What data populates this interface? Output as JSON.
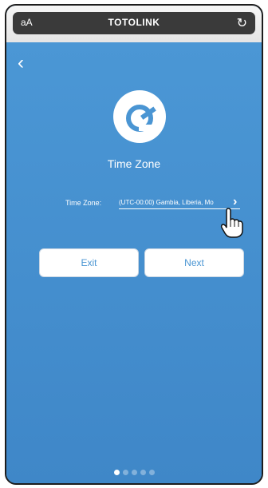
{
  "browser": {
    "text_size_label": "aA",
    "url_title": "TOTOLINK"
  },
  "page": {
    "title": "Time Zone",
    "time_zone_label": "Time Zone:",
    "time_zone_value": "(UTC-00:00) Gambia, Liberia, Mo",
    "buttons": {
      "exit": "Exit",
      "next": "Next"
    },
    "pagination": {
      "total": 5,
      "current": 1
    }
  },
  "colors": {
    "background": "#4a95d3",
    "button_text": "#4a95d3"
  },
  "icons": {
    "back": "chevron-left-icon",
    "reload": "reload-icon",
    "logo": "totolink-logo-icon",
    "select_arrow": "chevron-right-icon",
    "pointer": "hand-pointer-icon"
  }
}
